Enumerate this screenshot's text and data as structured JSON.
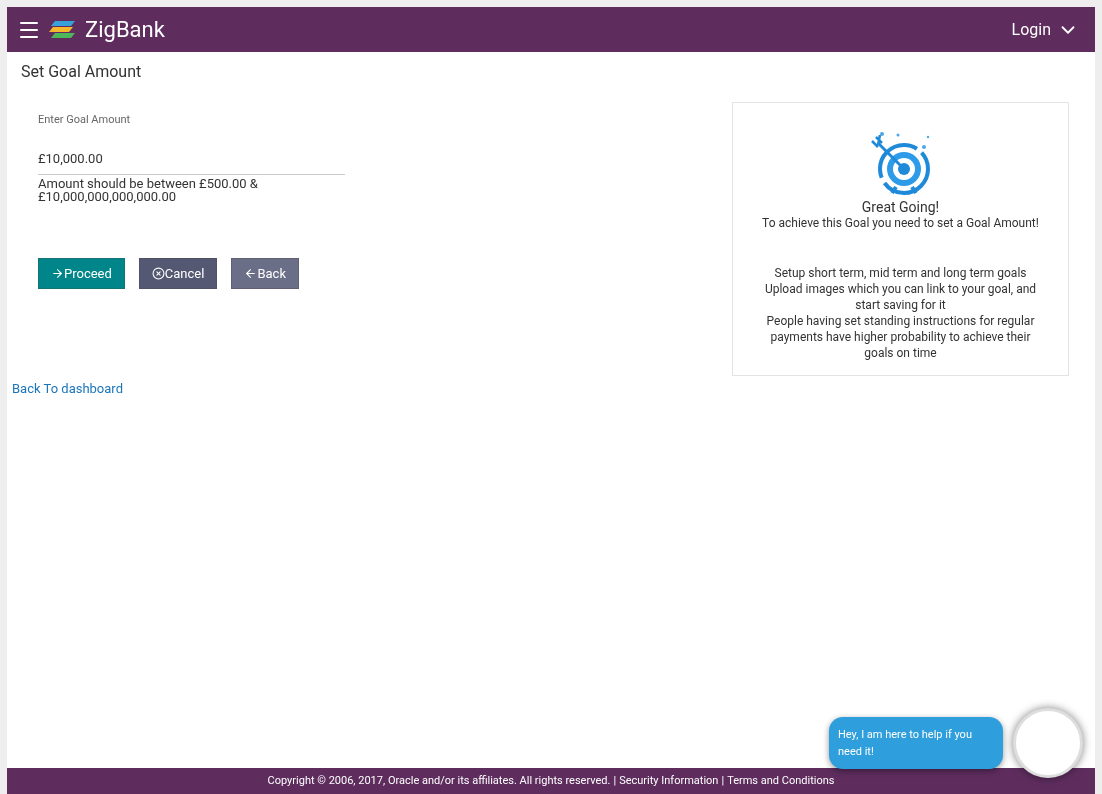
{
  "header": {
    "brand": "ZigBank",
    "login": "Login"
  },
  "page_title": "Set Goal Amount",
  "form": {
    "label": "Enter Goal Amount",
    "value": "£10,000.00",
    "hint": "Amount should be between £500.00 & £10,000,000,000,000.00"
  },
  "buttons": [
    {
      "kind": "proceed",
      "label": "Proceed"
    },
    {
      "kind": "cancel",
      "label": "Cancel"
    },
    {
      "kind": "back",
      "label": "Back"
    }
  ],
  "back_link": "Back To dashboard",
  "info_card": {
    "title": "Great Going!",
    "subtitle": "To achieve this Goal you need to set a Goal Amount!",
    "tips": [
      "Setup short term, mid term and long term goals",
      "Upload images which you can link to your goal, and start saving for it",
      "People having set standing instructions for regular payments have higher probability to achieve their goals on time"
    ]
  },
  "chat": {
    "message": "Hey, I am here to help if you need it!"
  },
  "footer": {
    "copyright": "Copyright © 2006, 2017, Oracle and/or its affiliates. All rights reserved.",
    "links": [
      {
        "separator": "|",
        "text": "Security Information"
      },
      {
        "separator": "|",
        "text": "Terms and Conditions"
      }
    ]
  }
}
